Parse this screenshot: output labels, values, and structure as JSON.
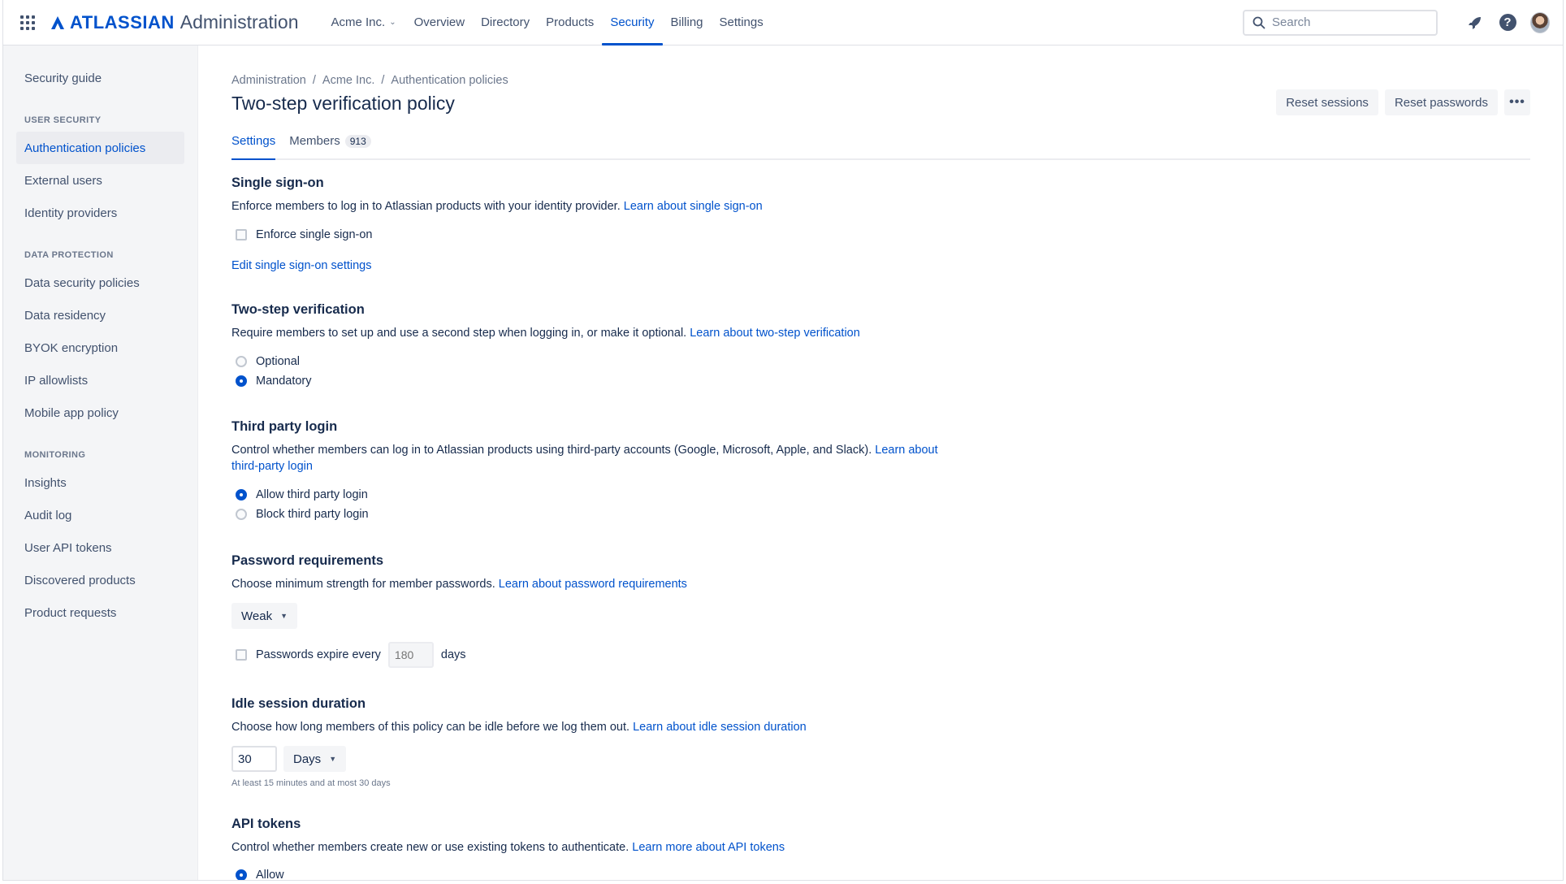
{
  "topnav": {
    "brand": "ATLASSIAN",
    "product": "Administration",
    "org": "Acme Inc.",
    "items": [
      {
        "label": "Overview",
        "active": false
      },
      {
        "label": "Directory",
        "active": false
      },
      {
        "label": "Products",
        "active": false
      },
      {
        "label": "Security",
        "active": true
      },
      {
        "label": "Billing",
        "active": false
      },
      {
        "label": "Settings",
        "active": false
      }
    ],
    "search_placeholder": "Search",
    "help_label": "?"
  },
  "sidebar": {
    "top_item": "Security guide",
    "groups": [
      {
        "heading": "USER SECURITY",
        "items": [
          "Authentication policies",
          "External users",
          "Identity providers"
        ]
      },
      {
        "heading": "DATA PROTECTION",
        "items": [
          "Data security policies",
          "Data residency",
          "BYOK encryption",
          "IP allowlists",
          "Mobile app policy"
        ]
      },
      {
        "heading": "MONITORING",
        "items": [
          "Insights",
          "Audit log",
          "User API tokens",
          "Discovered products",
          "Product requests"
        ]
      }
    ],
    "active_item": "Authentication policies"
  },
  "main": {
    "breadcrumb": [
      "Administration",
      "Acme Inc.",
      "Authentication policies"
    ],
    "breadcrumb_sep": "/",
    "title": "Two-step verification policy",
    "actions": {
      "reset_sessions": "Reset sessions",
      "reset_passwords": "Reset passwords",
      "more": "•••"
    },
    "tabs": [
      {
        "label": "Settings",
        "active": true
      },
      {
        "label": "Members",
        "badge": "913",
        "active": false
      }
    ],
    "sso": {
      "title": "Single sign-on",
      "desc": "Enforce members to log in to Atlassian products with your identity provider.",
      "link": "Learn about single sign-on",
      "checkbox": "Enforce single sign-on",
      "edit_link": "Edit single sign-on settings"
    },
    "two_step": {
      "title": "Two-step verification",
      "desc": "Require members to set up and use a second step when logging in, or make it optional.",
      "link": "Learn about two-step verification",
      "options": [
        "Optional",
        "Mandatory"
      ],
      "selected": "Mandatory"
    },
    "third_party": {
      "title": "Third party login",
      "desc": "Control whether members can log in to Atlassian products using third-party accounts (Google, Microsoft, Apple, and Slack).",
      "link_a": "Learn about",
      "link_b": "third-party login",
      "options": [
        "Allow third party login",
        "Block third party login"
      ],
      "selected": "Allow third party login"
    },
    "password": {
      "title": "Password requirements",
      "desc": "Choose minimum strength for member passwords.",
      "link": "Learn about password requirements",
      "strength": "Weak",
      "expire_label": "Passwords expire every",
      "expire_placeholder": "180",
      "expire_unit": "days"
    },
    "idle": {
      "title": "Idle session duration",
      "desc": "Choose how long members of this policy can be idle before we log them out.",
      "link": "Learn about idle session duration",
      "value": "30",
      "unit": "Days",
      "helper": "At least 15 minutes and at most 30 days"
    },
    "api": {
      "title": "API tokens",
      "desc": "Control whether members create new or use existing tokens to authenticate.",
      "link": "Learn more about API tokens",
      "option": "Allow"
    }
  }
}
